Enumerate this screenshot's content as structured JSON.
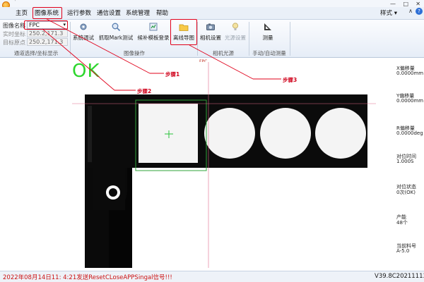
{
  "window": {
    "title_glyph": "˙",
    "controls": {
      "minimize": "—",
      "maximize": "□",
      "close": "✕"
    }
  },
  "menubar": {
    "items": [
      "主页",
      "图像系统",
      "运行参数",
      "通信设置",
      "系统管理",
      "帮助"
    ],
    "style_label": "样式",
    "style_caret": "▾",
    "ribbon_toggle": "∧",
    "help_icon_label": "?"
  },
  "ribbon": {
    "image_name_label": "图像名称",
    "image_name_value": "FPC",
    "actual_coord_label": "实时坐标",
    "actual_coord_value": "250.2,171.3",
    "target_origin_label": "目标原点",
    "target_origin_value": "250.2,171.3",
    "group_channel_label": "通道选择/坐标显示",
    "buttons": {
      "system_debug": "系统调试",
      "grab_mark": "抓取Mark测试",
      "compensate_template": "候补模板登录",
      "offline_guide": "离线导图",
      "camera_settings": "相机设置",
      "light_source": "光源设置",
      "measure": "测量"
    },
    "group_image_label": "图像操作",
    "group_camera_label": "相机光源",
    "group_manual_label": "手动/自动测量"
  },
  "view": {
    "label": "FPC",
    "ok_text": "OK"
  },
  "annotations": {
    "step1": "步骤1",
    "step2": "步骤2",
    "step3": "步骤3"
  },
  "info_panel": [
    {
      "label": "X偏移量",
      "value": "0.0000mm"
    },
    {
      "label": "Y偏移量",
      "value": "0.0000mm"
    },
    {
      "label": "R偏移量",
      "value": "0.0000deg"
    },
    {
      "label": "对位时间",
      "value": "1.000S"
    },
    {
      "label": "对位状态",
      "value": "0次(OK)"
    },
    {
      "label": "产能",
      "value": "48个"
    },
    {
      "label": "当前料号",
      "value": "A-5.0"
    }
  ],
  "statusbar": {
    "message": "2022年08月14日11: 4:21发送ResetCLoseAPPSingal信号!!!",
    "version": "V39.8C20211113Q"
  },
  "colors": {
    "annotation_red": "#e0001a",
    "ok_green": "#2dd62d",
    "status_red": "#cc1010"
  }
}
